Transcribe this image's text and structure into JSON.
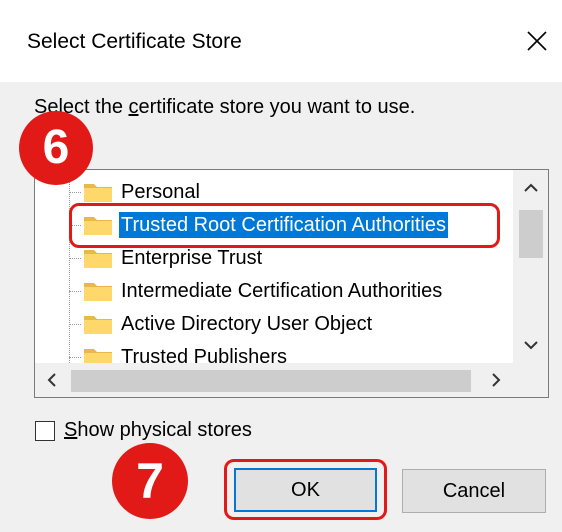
{
  "dialog": {
    "title": "Select Certificate Store",
    "close_icon": "close-icon",
    "instruction_prefix": "Select the ",
    "instruction_underlined": "c",
    "instruction_suffix": "ertificate store you want to use."
  },
  "tree": {
    "items": [
      {
        "label": "Personal",
        "icon": "folder-icon",
        "selected": false
      },
      {
        "label": "Trusted Root Certification Authorities",
        "icon": "folder-icon",
        "selected": true
      },
      {
        "label": "Enterprise Trust",
        "icon": "folder-icon",
        "selected": false
      },
      {
        "label": "Intermediate Certification Authorities",
        "icon": "folder-icon",
        "selected": false
      },
      {
        "label": "Active Directory User Object",
        "icon": "folder-icon",
        "selected": false
      },
      {
        "label": "Trusted Publishers",
        "icon": "folder-icon",
        "selected": false
      }
    ],
    "scroll_up_icon": "chevron-up-icon",
    "scroll_down_icon": "chevron-down-icon",
    "scroll_left_icon": "chevron-left-icon",
    "scroll_right_icon": "chevron-right-icon"
  },
  "options": {
    "show_physical_prefix": "",
    "show_physical_underlined": "S",
    "show_physical_suffix": "how physical stores",
    "show_physical_checked": false
  },
  "buttons": {
    "ok_label": "OK",
    "cancel_label": "Cancel"
  },
  "annotations": {
    "step_6": "6",
    "step_7": "7",
    "highlight_color": "#e11a18"
  },
  "colors": {
    "selection": "#0078d7",
    "dialog_bg": "#f0f0f0"
  }
}
